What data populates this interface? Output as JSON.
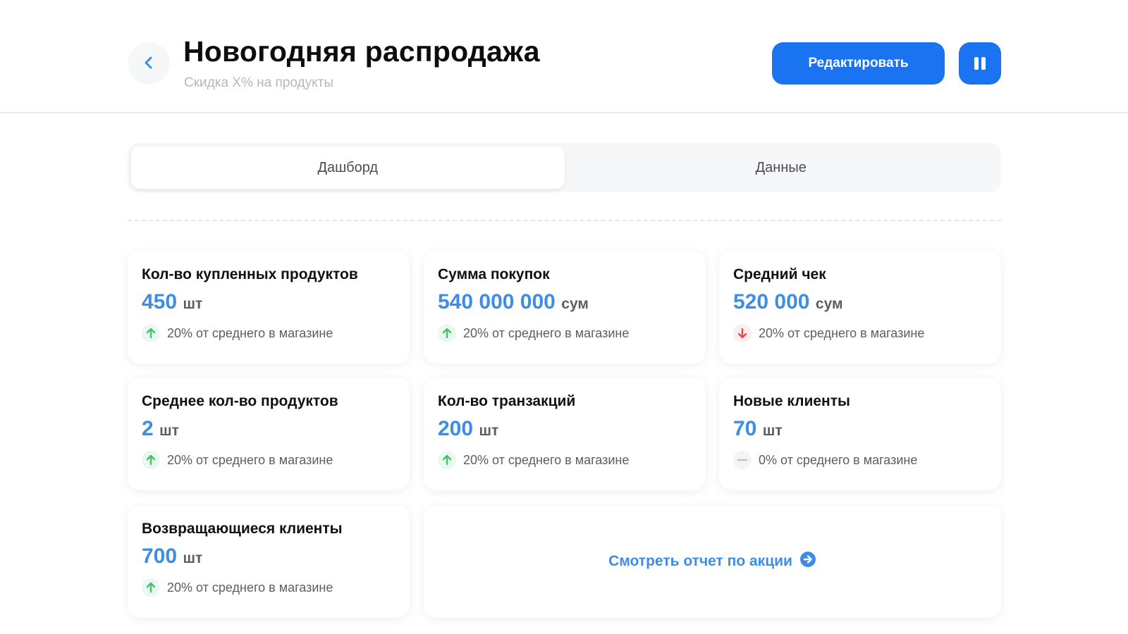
{
  "header": {
    "title": "Новогодняя распродажа",
    "subtitle": "Скидка X% на продукты",
    "edit_label": "Редактировать"
  },
  "tabs": [
    {
      "label": "Дашборд",
      "active": true
    },
    {
      "label": "Данные",
      "active": false
    }
  ],
  "cards": [
    {
      "title": "Кол-во купленных продуктов",
      "value": "450",
      "unit": "шт",
      "trend": "up",
      "trend_text": "20% от среднего в магазине"
    },
    {
      "title": "Сумма покупок",
      "value": "540 000 000",
      "unit": "сум",
      "trend": "up",
      "trend_text": "20% от среднего в магазине"
    },
    {
      "title": "Средний чек",
      "value": "520 000",
      "unit": "сум",
      "trend": "down",
      "trend_text": "20% от среднего в магазине"
    },
    {
      "title": "Среднее кол-во продуктов",
      "value": "2",
      "unit": "шт",
      "trend": "up",
      "trend_text": "20% от среднего в магазине"
    },
    {
      "title": "Кол-во транзакций",
      "value": "200",
      "unit": "шт",
      "trend": "up",
      "trend_text": "20% от среднего в магазине"
    },
    {
      "title": "Новые клиенты",
      "value": "70",
      "unit": "шт",
      "trend": "flat",
      "trend_text": "0% от среднего в магазине"
    },
    {
      "title": "Возвращающиеся клиенты",
      "value": "700",
      "unit": "шт",
      "trend": "up",
      "trend_text": "20% от среднего в магазине"
    }
  ],
  "report": {
    "label": "Смотреть отчет по акции"
  },
  "colors": {
    "primary": "#1a73f0",
    "value": "#3e8de4",
    "trend_up": "#3fc26b",
    "trend_down": "#e5484d",
    "trend_flat": "#c2c5c9"
  },
  "icons": {
    "back": "chevron-left-icon",
    "pause": "pause-icon",
    "trend_up": "arrow-up-icon",
    "trend_down": "arrow-down-icon",
    "trend_flat": "minus-icon",
    "report": "arrow-right-circle-icon"
  }
}
